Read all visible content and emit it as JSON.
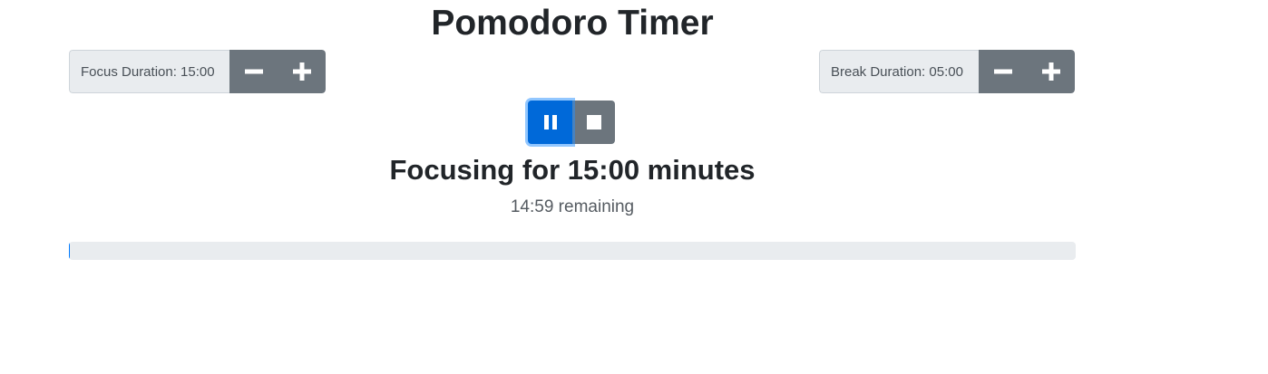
{
  "title": "Pomodoro Timer",
  "focus": {
    "label": "Focus Duration: 15:00",
    "decrement_icon": "minus-icon",
    "increment_icon": "plus-icon"
  },
  "break": {
    "label": "Break Duration: 05:00",
    "decrement_icon": "minus-icon",
    "increment_icon": "plus-icon"
  },
  "controls": {
    "pause_icon": "pause-icon",
    "stop_icon": "stop-icon"
  },
  "status": {
    "heading": "Focusing for 15:00 minutes",
    "remaining": "14:59 remaining"
  },
  "progress": {
    "fraction": 0.001
  },
  "colors": {
    "primary": "#0069d9",
    "secondary": "#6c757d",
    "track": "#e9ecef",
    "label_bg": "#e9ecef"
  }
}
